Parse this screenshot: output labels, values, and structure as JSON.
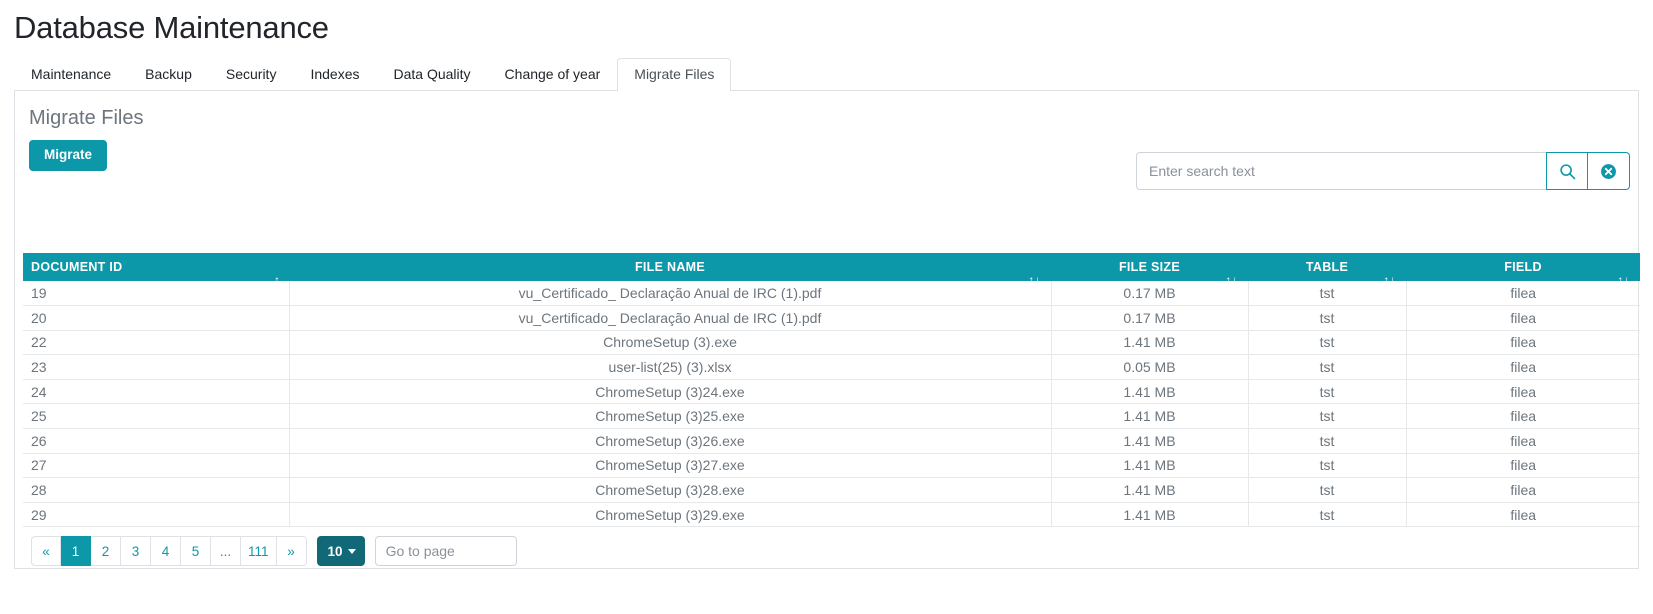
{
  "header": {
    "title": "Database Maintenance"
  },
  "tabs": [
    {
      "label": "Maintenance",
      "active": false
    },
    {
      "label": "Backup",
      "active": false
    },
    {
      "label": "Security",
      "active": false
    },
    {
      "label": "Indexes",
      "active": false
    },
    {
      "label": "Data Quality",
      "active": false
    },
    {
      "label": "Change of year",
      "active": false
    },
    {
      "label": "Migrate Files",
      "active": true
    }
  ],
  "panel": {
    "section_title": "Migrate Files",
    "migrate_button": "Migrate"
  },
  "search": {
    "placeholder": "Enter search text",
    "value": "",
    "search_icon": "search-icon",
    "clear_icon": "clear-circle-icon"
  },
  "table": {
    "columns": [
      {
        "key": "document_id",
        "label": "DOCUMENT ID",
        "sort": "asc",
        "sort_glyph": "↑",
        "align": "left"
      },
      {
        "key": "file_name",
        "label": "FILE NAME",
        "sort": "none",
        "sort_glyph": "↑↓",
        "align": "center"
      },
      {
        "key": "file_size",
        "label": "FILE SIZE",
        "sort": "none",
        "sort_glyph": "↑↓",
        "align": "center"
      },
      {
        "key": "table",
        "label": "TABLE",
        "sort": "none",
        "sort_glyph": "↑↓",
        "align": "center"
      },
      {
        "key": "field",
        "label": "FIELD",
        "sort": "none",
        "sort_glyph": "↑↓",
        "align": "center"
      }
    ],
    "rows": [
      {
        "document_id": "19",
        "file_name": "vu_Certificado_ Declaração Anual de IRC (1).pdf",
        "file_size": "0.17 MB",
        "table": "tst",
        "field": "filea"
      },
      {
        "document_id": "20",
        "file_name": "vu_Certificado_ Declaração Anual de IRC (1).pdf",
        "file_size": "0.17 MB",
        "table": "tst",
        "field": "filea"
      },
      {
        "document_id": "22",
        "file_name": "ChromeSetup (3).exe",
        "file_size": "1.41 MB",
        "table": "tst",
        "field": "filea"
      },
      {
        "document_id": "23",
        "file_name": "user-list(25) (3).xlsx",
        "file_size": "0.05 MB",
        "table": "tst",
        "field": "filea"
      },
      {
        "document_id": "24",
        "file_name": "ChromeSetup (3)24.exe",
        "file_size": "1.41 MB",
        "table": "tst",
        "field": "filea"
      },
      {
        "document_id": "25",
        "file_name": "ChromeSetup (3)25.exe",
        "file_size": "1.41 MB",
        "table": "tst",
        "field": "filea"
      },
      {
        "document_id": "26",
        "file_name": "ChromeSetup (3)26.exe",
        "file_size": "1.41 MB",
        "table": "tst",
        "field": "filea"
      },
      {
        "document_id": "27",
        "file_name": "ChromeSetup (3)27.exe",
        "file_size": "1.41 MB",
        "table": "tst",
        "field": "filea"
      },
      {
        "document_id": "28",
        "file_name": "ChromeSetup (3)28.exe",
        "file_size": "1.41 MB",
        "table": "tst",
        "field": "filea"
      },
      {
        "document_id": "29",
        "file_name": "ChromeSetup (3)29.exe",
        "file_size": "1.41 MB",
        "table": "tst",
        "field": "filea"
      }
    ]
  },
  "pagination": {
    "pages": [
      {
        "label": "«",
        "type": "prev",
        "active": false
      },
      {
        "label": "1",
        "type": "page",
        "active": true
      },
      {
        "label": "2",
        "type": "page",
        "active": false
      },
      {
        "label": "3",
        "type": "page",
        "active": false
      },
      {
        "label": "4",
        "type": "page",
        "active": false
      },
      {
        "label": "5",
        "type": "page",
        "active": false
      },
      {
        "label": "...",
        "type": "ellipsis",
        "active": false
      },
      {
        "label": "111",
        "type": "page",
        "active": false
      },
      {
        "label": "»",
        "type": "next",
        "active": false
      }
    ],
    "page_size": "10",
    "goto_placeholder": "Go to page",
    "goto_value": ""
  },
  "colors": {
    "accent": "#0c98a8",
    "accent_dark": "#116977",
    "text_muted": "#6c757d",
    "border": "#dee2e6"
  }
}
